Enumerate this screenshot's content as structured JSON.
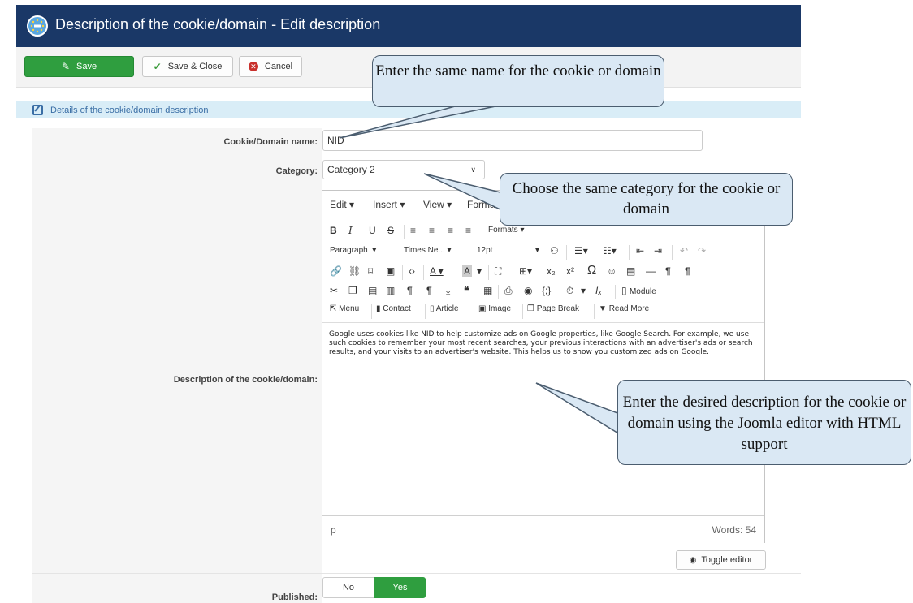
{
  "window": {
    "title": "Description of the cookie/domain - Edit description"
  },
  "toolbar": {
    "save_label": "Save",
    "save_close_label": "Save & Close",
    "cancel_label": "Cancel"
  },
  "section": {
    "header": "Details of the cookie/domain description"
  },
  "form": {
    "name_label": "Cookie/Domain name:",
    "name_value": "NID",
    "category_label": "Category:",
    "category_value": "Category 2",
    "description_label": "Description of the cookie/domain:",
    "published_label": "Published:",
    "published_no": "No",
    "published_yes": "Yes",
    "published_selected": "Yes"
  },
  "editor": {
    "menu": [
      "Edit ▾",
      "Insert ▾",
      "View ▾",
      "Format"
    ],
    "formats_label": "Formats ▾",
    "paragraph_label": "Paragraph",
    "font_label": "Times Ne...",
    "size_label": "12pt",
    "module_label": "Module",
    "menu_btn": "Menu",
    "contact_btn": "Contact",
    "article_btn": "Article",
    "image_btn": "Image",
    "pagebreak_btn": "Page Break",
    "readmore_btn": "Read More",
    "content": "Google uses cookies like NID to help customize ads on Google properties, like Google Search. For example, we use such cookies to remember your most recent searches, your previous interactions with an advertiser's ads or search results, and your visits to an advertiser's website. This helps us to show you customized ads on Google.",
    "status_path": "p",
    "word_count": "Words: 54",
    "toggle_label": "Toggle editor"
  },
  "callouts": {
    "name": "Enter the same name for the cookie or domain",
    "category": "Choose the same category for the cookie or domain",
    "description": "Enter the desired description for the cookie or domain using the Joomla editor with HTML support"
  },
  "colors": {
    "titlebar": "#1a3867",
    "save_green": "#2f9e3f",
    "section_bg": "#d9edf7",
    "callout_bg": "#dae8f4",
    "cancel_red": "#c9302c"
  }
}
